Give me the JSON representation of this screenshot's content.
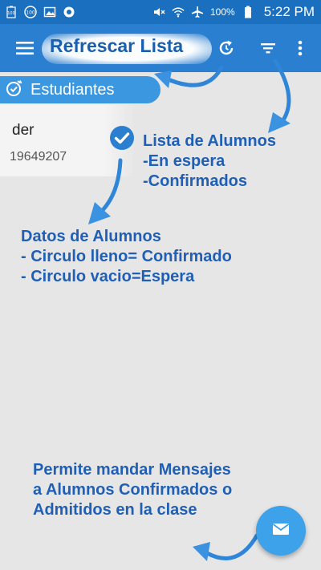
{
  "status_bar": {
    "battery_percent": "100%",
    "time": "5:22 PM",
    "left_icons": [
      "battery-100-icon",
      "volume-100-icon",
      "image-icon",
      "record-icon"
    ],
    "right_icons": [
      "mute-icon",
      "wifi-icon",
      "airplane-icon",
      "battery-icon"
    ]
  },
  "app_bar": {
    "title": "Refrescar Lista",
    "icons": [
      "menu-icon",
      "refresh-icon",
      "filter-icon",
      "overflow-icon"
    ]
  },
  "section": {
    "label": "Estudiantes",
    "icon": "clock-check-icon"
  },
  "student": {
    "name": "der",
    "id": "19649207"
  },
  "annotations": {
    "list": {
      "line1": "Lista de Alumnos",
      "line2": "-En espera",
      "line3": "-Confirmados"
    },
    "data": {
      "line1": "Datos de Alumnos",
      "line2": "- Circulo lleno= Confirmado",
      "line3": "- Circulo vacio=Espera"
    },
    "message": {
      "line1": "Permite mandar Mensajes",
      "line2": "a Alumnos Confirmados o",
      "line3": "Admitidos en la clase"
    }
  },
  "fab": {
    "icon": "mail-icon"
  },
  "colors": {
    "status_bar": "#1a6fbf",
    "app_bar": "#2a7fd0",
    "tab": "#3a97e0",
    "annotation_text": "#1f5fb5",
    "fab": "#3da2ea",
    "background": "#e6e6e6"
  }
}
